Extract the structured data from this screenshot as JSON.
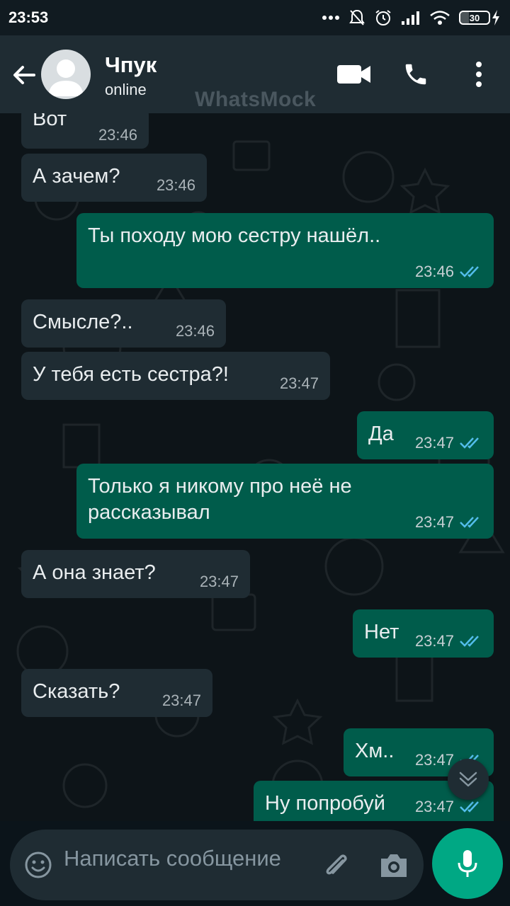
{
  "status_bar": {
    "time": "23:53",
    "battery": "30"
  },
  "header": {
    "contact_name": "Чпук",
    "contact_status": "online",
    "watermark": "WhatsMock"
  },
  "messages": [
    {
      "dir": "in",
      "text": "Вот",
      "time": "23:46"
    },
    {
      "dir": "in",
      "text": "А зачем?",
      "time": "23:46"
    },
    {
      "dir": "out",
      "text": "Ты походу мою сестру нашёл..",
      "time": "23:46",
      "read": true
    },
    {
      "dir": "in",
      "text": "Смысле?..",
      "time": "23:46"
    },
    {
      "dir": "in",
      "text": "У тебя есть сестра?!",
      "time": "23:47"
    },
    {
      "dir": "out",
      "text": "Да",
      "time": "23:47",
      "read": true
    },
    {
      "dir": "out",
      "text": "Только я никому про неё не рассказывал",
      "time": "23:47",
      "read": true
    },
    {
      "dir": "in",
      "text": "А она знает?",
      "time": "23:47"
    },
    {
      "dir": "out",
      "text": "Нет",
      "time": "23:47",
      "read": true
    },
    {
      "dir": "in",
      "text": "Сказать?",
      "time": "23:47"
    },
    {
      "dir": "out",
      "text": "Хм..",
      "time": "23:47",
      "read": true
    },
    {
      "dir": "out",
      "text": "Ну попробуй",
      "time": "23:47",
      "read": true
    }
  ],
  "composer": {
    "placeholder": "Написать сообщение"
  },
  "colors": {
    "accent": "#00a884",
    "outgoing_bubble": "#005c4b",
    "incoming_bubble": "#1f2c33",
    "read_ticks": "#53bdeb"
  }
}
